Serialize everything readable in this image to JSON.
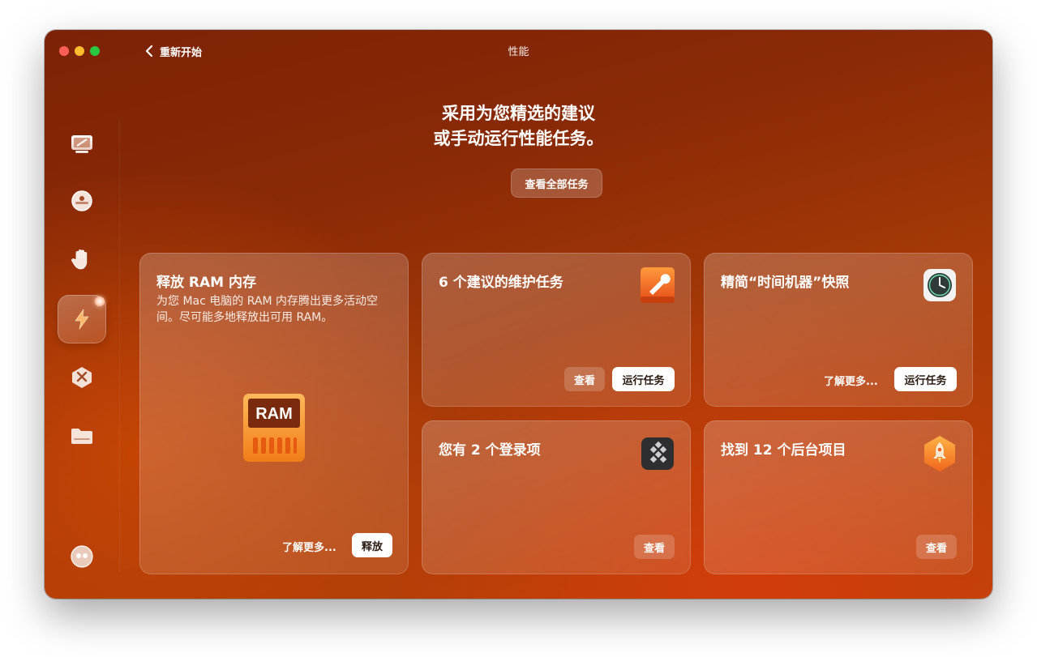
{
  "window": {
    "title": "性能"
  },
  "nav": {
    "back_label": "重新开始"
  },
  "sidebar": {
    "items": [
      {
        "icon": "monitor-icon"
      },
      {
        "icon": "shield-disc-icon"
      },
      {
        "icon": "hand-icon"
      },
      {
        "icon": "lightning-icon",
        "active": true
      },
      {
        "icon": "tools-icon"
      },
      {
        "icon": "folder-icon"
      }
    ],
    "footer_icon": "assistant-icon"
  },
  "headline": {
    "line1": "采用为您精选的建议",
    "line2": "或手动运行性能任务。"
  },
  "view_all_label": "查看全部任务",
  "cards": {
    "ram": {
      "title": "释放 RAM 内存",
      "description": "为您 Mac 电脑的 RAM 内存腾出更多活动空间。尽可能多地释放出可用 RAM。",
      "icon_text": "RAM",
      "learn_more": "了解更多...",
      "action": "释放"
    },
    "maintenance": {
      "title": "6 个建议的维护任务",
      "view": "查看",
      "run": "运行任务"
    },
    "time_machine": {
      "title": "精简“时间机器”快照",
      "learn_more": "了解更多...",
      "run": "运行任务"
    },
    "login_items": {
      "title": "您有 2 个登录项",
      "view": "查看"
    },
    "background_items": {
      "title": "找到 12 个后台项目",
      "view": "查看"
    }
  },
  "colors": {
    "window_bg_dark": "#7c2206",
    "window_bg_light": "#bb4408",
    "accent": "#ff7a2e"
  }
}
